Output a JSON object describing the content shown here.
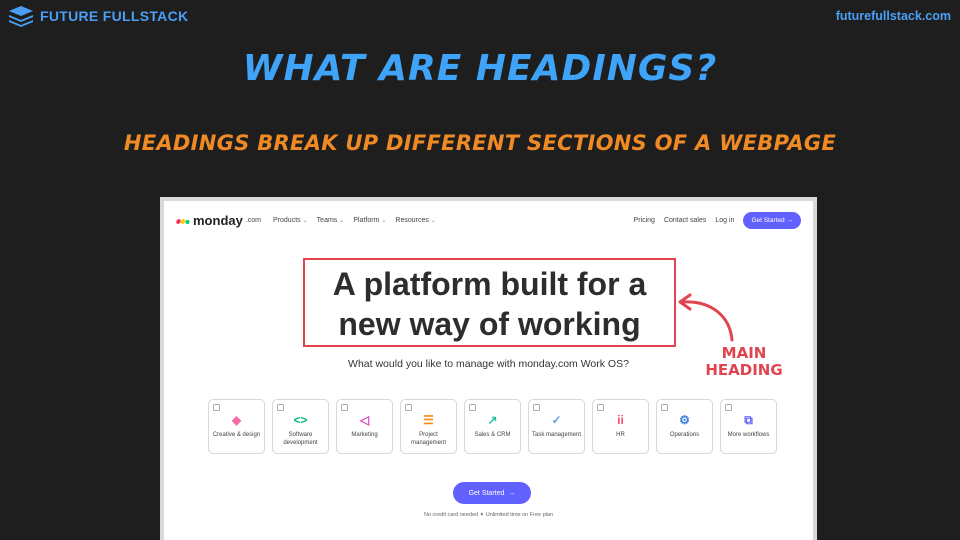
{
  "brand": {
    "name": "FUTURE FULLSTACK",
    "url": "futurefullstack.com"
  },
  "slide": {
    "title": "WHAT ARE HEADINGS?",
    "subtitle": "HEADINGS BREAK UP DIFFERENT SECTIONS OF A WEBPAGE"
  },
  "nav": {
    "logo": "monday",
    "logo_suffix": ".com",
    "menu": [
      "Products",
      "Teams",
      "Platform",
      "Resources"
    ],
    "pricing": "Pricing",
    "contact": "Contact sales",
    "login": "Log in",
    "cta": "Get Started"
  },
  "hero": {
    "line1": "A platform built for a",
    "line2": "new way of working",
    "question": "What would you like to manage with monday.com Work OS?"
  },
  "cards": [
    {
      "label": "Creative & design",
      "icon": "shapes-icon",
      "color": "#f26ba8",
      "glyph": "◆"
    },
    {
      "label": "Software development",
      "icon": "code-icon",
      "color": "#00b884",
      "glyph": "<>"
    },
    {
      "label": "Marketing",
      "icon": "megaphone-icon",
      "color": "#e040c9",
      "glyph": "◁"
    },
    {
      "label": "Project management",
      "icon": "bars-icon",
      "color": "#fb8c1a",
      "glyph": "☰"
    },
    {
      "label": "Sales & CRM",
      "icon": "trend-icon",
      "color": "#1fbfa8",
      "glyph": "↗"
    },
    {
      "label": "Task management",
      "icon": "check-icon",
      "color": "#5ea0e8",
      "glyph": "✓"
    },
    {
      "label": "HR",
      "icon": "people-icon",
      "color": "#f2556b",
      "glyph": "ii"
    },
    {
      "label": "Operations",
      "icon": "gears-icon",
      "color": "#3b7fd8",
      "glyph": "⚙"
    },
    {
      "label": "More workflows",
      "icon": "stack-icon",
      "color": "#6161ff",
      "glyph": "⧉"
    }
  ],
  "cta": {
    "label": "Get Started",
    "note": "No credit card needed  ✦  Unlimited time on Free plan"
  },
  "annotation": {
    "line1": "MAIN",
    "line2": "HEADING"
  }
}
